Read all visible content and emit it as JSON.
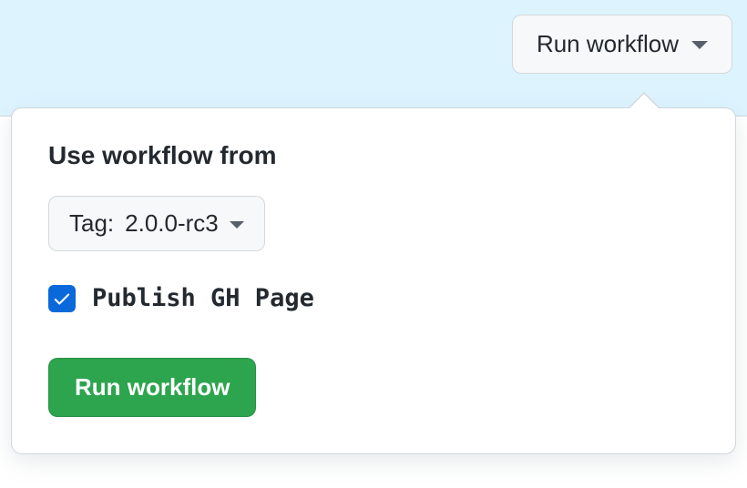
{
  "trigger": {
    "label": "Run workflow"
  },
  "panel": {
    "section_title": "Use workflow from",
    "branch": {
      "prefix": "Tag:",
      "value": "2.0.0-rc3"
    },
    "options": {
      "publish_label": "Publish GH Page",
      "publish_checked": true
    },
    "submit_label": "Run workflow"
  }
}
